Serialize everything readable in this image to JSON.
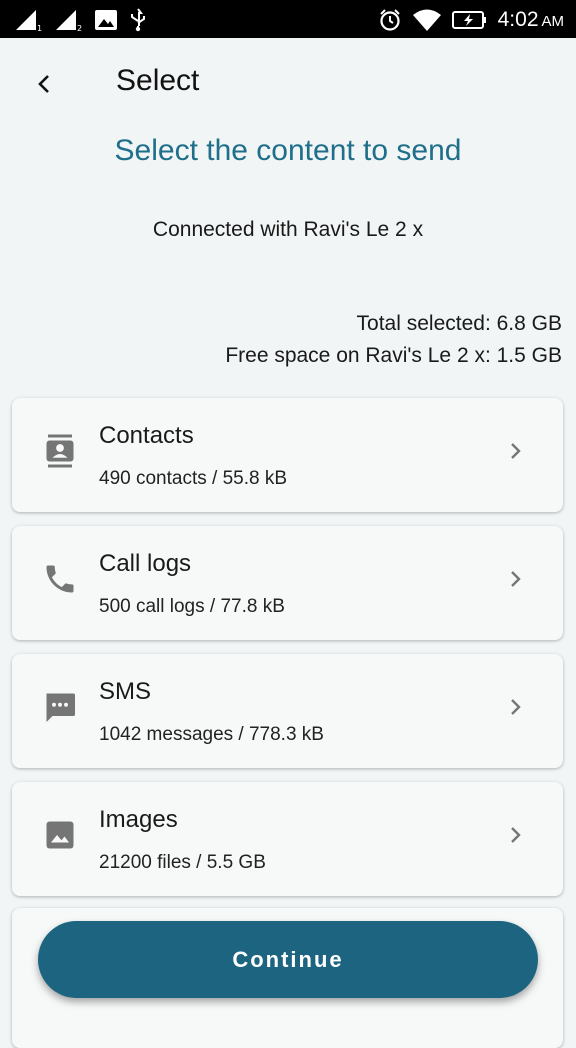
{
  "status_bar": {
    "time": "4:02",
    "ampm": "AM",
    "icons": [
      "signal-1-icon",
      "signal-2-icon",
      "image-icon",
      "usb-icon",
      "alarm-icon",
      "wifi-icon",
      "battery-charging-icon"
    ]
  },
  "appbar": {
    "title": "Select",
    "back_icon": "back-arrow-icon"
  },
  "heading": "Select the content to send",
  "connected": "Connected with Ravi's Le 2 x",
  "totals": {
    "total_selected": "Total selected: 6.8 GB",
    "free_space": "Free space on Ravi's Le 2 x: 1.5 GB"
  },
  "items": [
    {
      "title": "Contacts",
      "subtitle": "490 contacts / 55.8 kB",
      "icon": "contacts-icon"
    },
    {
      "title": "Call logs",
      "subtitle": "500 call logs / 77.8 kB",
      "icon": "phone-icon"
    },
    {
      "title": "SMS",
      "subtitle": "1042 messages / 778.3 kB",
      "icon": "sms-icon"
    },
    {
      "title": "Images",
      "subtitle": "21200 files / 5.5 GB",
      "icon": "image-icon"
    }
  ],
  "continue_label": "Continue",
  "colors": {
    "accent": "#1f6f8b",
    "button": "#1d6480",
    "icon_gray": "#757575",
    "background": "#f1f5f5"
  }
}
